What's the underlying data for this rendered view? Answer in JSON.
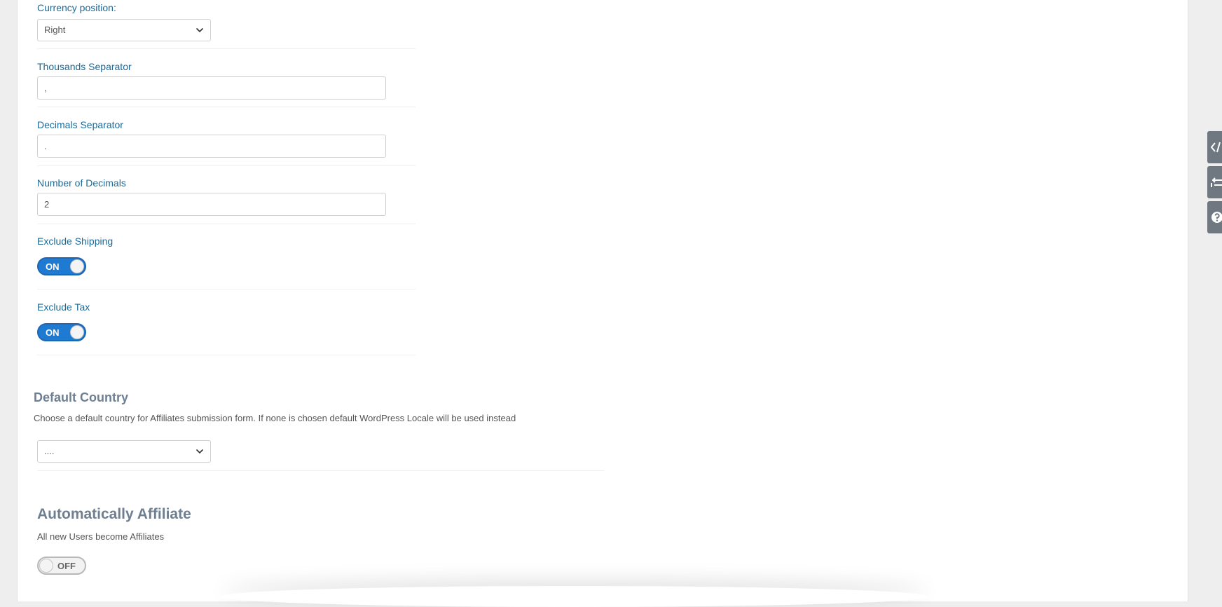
{
  "currency_position": {
    "label": "Currency position:",
    "selected": "Right"
  },
  "thousands_separator": {
    "label": "Thousands Separator",
    "value": ","
  },
  "decimals_separator": {
    "label": "Decimals Separator",
    "value": "."
  },
  "number_of_decimals": {
    "label": "Number of Decimals",
    "value": "2"
  },
  "exclude_shipping": {
    "label": "Exclude Shipping",
    "state": "ON"
  },
  "exclude_tax": {
    "label": "Exclude Tax",
    "state": "ON"
  },
  "default_country": {
    "title": "Default Country",
    "description": "Choose a default country for Affiliates submission form. If none is chosen default WordPress Locale will be used instead",
    "selected": "...."
  },
  "automatically_affiliate": {
    "title": "Automatically Affiliate",
    "description": "All new Users become Affiliates",
    "state": "OFF"
  },
  "side_tabs": {
    "icons": [
      "code-icon",
      "arrow-left-icon",
      "help-icon"
    ]
  },
  "colors": {
    "label_blue": "#1a6a9a",
    "toggle_on": "#1f7ad2",
    "section_title": "#6d7f91",
    "side_tab_bg": "#6f7780"
  }
}
